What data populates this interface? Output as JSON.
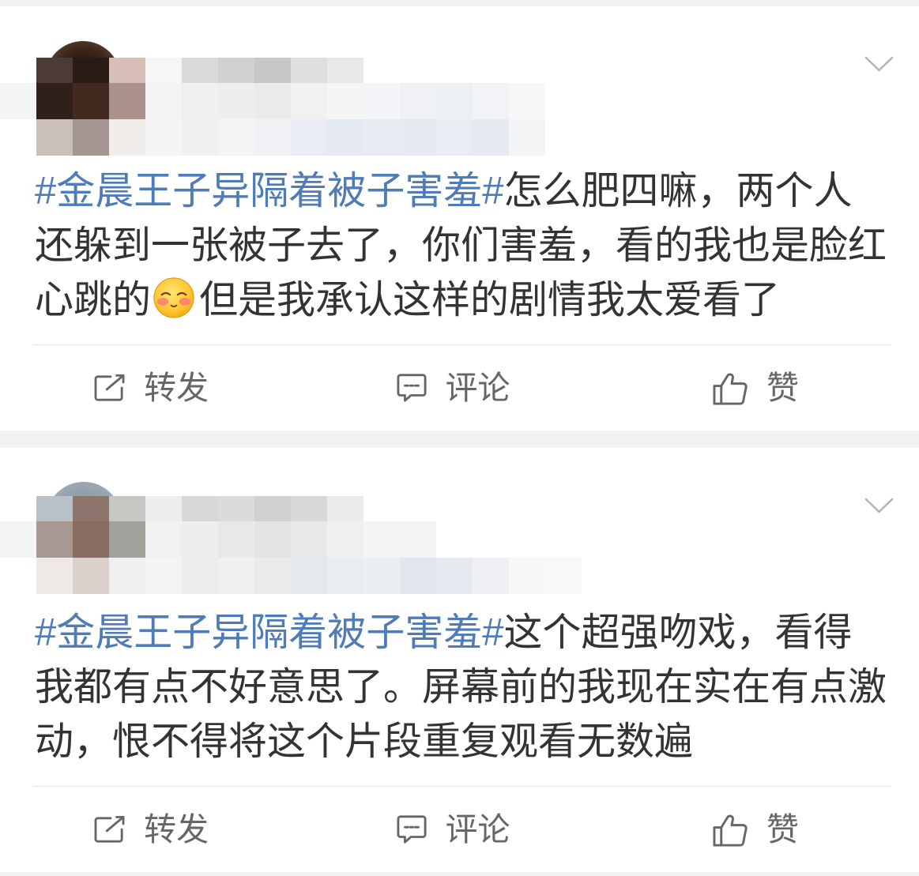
{
  "colors": {
    "page_background": "#f2f2f2",
    "card_background": "#ffffff",
    "text": "#333333",
    "hashtag": "#4f7bb6",
    "divider": "#e5e5e5",
    "action": "#666666",
    "chevron": "#b3b3b3"
  },
  "posts": [
    {
      "menu_icon": "chevron-down-icon",
      "hashtag": "#金晨王子异隔着被子害羞#",
      "text_before_emoji": "怎么肥四嘛，两个人还躲到一张被子去了，你们害羞，看的我也是脸红心跳的",
      "emoji": "shy-face-emoji-icon",
      "text_after_emoji": "但是我承认这样的剧情我太爱看了",
      "actions": [
        {
          "icon": "repost-icon",
          "label": "转发"
        },
        {
          "icon": "comment-icon",
          "label": "评论"
        },
        {
          "icon": "like-icon",
          "label": "赞"
        }
      ]
    },
    {
      "menu_icon": "chevron-down-icon",
      "hashtag": "#金晨王子异隔着被子害羞#",
      "text": "这个超强吻戏，看得我都有点不好意思了。屏幕前的我现在实在有点激动，恨不得将这个片段重复观看无数遍",
      "actions": [
        {
          "icon": "repost-icon",
          "label": "转发"
        },
        {
          "icon": "comment-icon",
          "label": "评论"
        },
        {
          "icon": "like-icon",
          "label": "赞"
        }
      ]
    }
  ]
}
